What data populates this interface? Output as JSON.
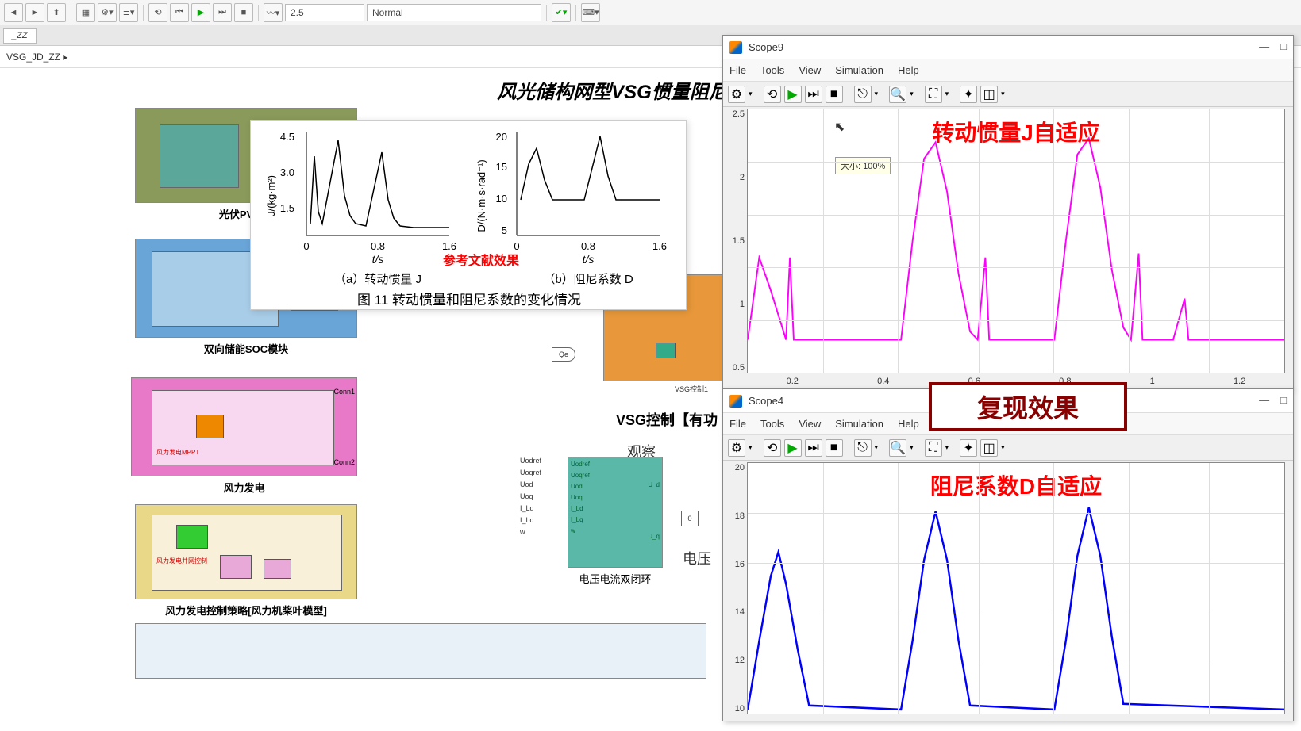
{
  "toolbar": {
    "stop_time": "2.5",
    "mode": "Normal"
  },
  "tab": "_ZZ",
  "breadcrumb": "VSG_JD_ZZ ▸",
  "canvas": {
    "title": "风光储构网型VSG惯量阻尼参数自适",
    "blocks": {
      "pv": "光伏PV+Bo",
      "soc": "双向储能SOC模块",
      "wind": "风力发电",
      "wind_ctrl": "风力发电控制策略[风力机桨叶模型]",
      "vsg_ctrl": "VSG控制【有功",
      "observe": "观察",
      "voltage": "电压",
      "vloop": "电压电流双闭环",
      "vsg_sub": "VSG控制1",
      "conn1": "Conn1",
      "conn2": "Conn2",
      "qe": "Qe",
      "zero": "0",
      "wind_mppt": "风力发电MPPT",
      "wind_grid": "风力发电并网控制"
    },
    "loop_ports": [
      "Uodref",
      "Uoqref",
      "Uod",
      "Uoq",
      "I_Ld",
      "I_Lq",
      "w"
    ],
    "loop_inner": [
      "Uodref",
      "Uoqref",
      "Uod",
      "Uoq",
      "I_Ld",
      "I_Lq",
      "w"
    ],
    "loop_out": [
      "U_d",
      "U_q"
    ]
  },
  "ref": {
    "y1_label": "J/(kg·m²)",
    "y2_label": "D/(N·m·s·rad⁻¹)",
    "x_label": "t/s",
    "sub_a": "（a）转动惯量 J",
    "sub_b": "（b）阻尼系数 D",
    "caption": "图 11   转动惯量和阻尼系数的变化情况",
    "red_label": "参考文献效果",
    "y1_ticks": [
      "4.5",
      "3.0",
      "1.5"
    ],
    "y2_ticks": [
      "20",
      "15",
      "10",
      "5"
    ],
    "x_ticks": [
      "0",
      "0.8",
      "1.6"
    ]
  },
  "scope9": {
    "title": "Scope9",
    "menus": [
      "File",
      "Tools",
      "View",
      "Simulation",
      "Help"
    ],
    "plot_title": "转动惯量J自适应",
    "tooltip": "大小: 100%",
    "y_ticks": [
      "2.5",
      "2",
      "1.5",
      "1",
      "0.5"
    ],
    "x_ticks": [
      "0.2",
      "0.4",
      "0.6",
      "0.8",
      "1",
      "1.2"
    ]
  },
  "scope4": {
    "title": "Scope4",
    "menus": [
      "File",
      "Tools",
      "View",
      "Simulation",
      "Help"
    ],
    "plot_title": "阻尼系数D自适应",
    "y_ticks": [
      "20",
      "18",
      "16",
      "14",
      "12",
      "10"
    ]
  },
  "redbox": "复现效果",
  "chart_data": [
    {
      "type": "line",
      "title": "转动惯量J自适应 (Scope9)",
      "xlabel": "t/s",
      "ylabel": "J",
      "xlim": [
        0,
        1.4
      ],
      "ylim": [
        0,
        2.5
      ],
      "series": [
        {
          "name": "J",
          "color": "#f0f",
          "x": [
            0.0,
            0.03,
            0.06,
            0.09,
            0.12,
            0.15,
            0.18,
            0.22,
            0.25,
            0.3,
            0.35,
            0.4,
            0.43,
            0.46,
            0.49,
            0.52,
            0.55,
            0.58,
            0.62,
            0.65,
            0.7,
            0.75,
            0.8,
            0.83,
            0.86,
            0.89,
            0.92,
            0.95,
            1.0,
            1.03,
            1.06,
            1.09,
            1.12,
            1.15,
            1.2,
            1.25,
            1.3,
            1.35,
            1.4
          ],
          "values": [
            0.3,
            1.0,
            0.8,
            0.6,
            0.4,
            0.3,
            0.3,
            1.1,
            0.3,
            0.3,
            0.3,
            0.3,
            1.0,
            1.7,
            2.1,
            1.8,
            1.2,
            0.6,
            0.3,
            0.3,
            1.1,
            0.3,
            0.3,
            1.0,
            1.7,
            2.1,
            1.8,
            1.2,
            0.6,
            0.3,
            0.3,
            1.2,
            0.3,
            0.3,
            0.3,
            0.7,
            0.3,
            0.3,
            0.3
          ]
        }
      ]
    },
    {
      "type": "line",
      "title": "阻尼系数D自适应 (Scope4)",
      "xlabel": "t/s",
      "ylabel": "D",
      "xlim": [
        0,
        1.4
      ],
      "ylim": [
        10,
        20
      ],
      "series": [
        {
          "name": "D",
          "color": "#00f",
          "x": [
            0.0,
            0.03,
            0.06,
            0.09,
            0.12,
            0.15,
            0.2,
            0.4,
            0.43,
            0.46,
            0.49,
            0.52,
            0.55,
            0.6,
            0.8,
            0.83,
            0.86,
            0.89,
            0.92,
            0.95,
            1.0,
            1.4
          ],
          "values": [
            10.0,
            13.0,
            15.5,
            16.5,
            15.0,
            12.0,
            10.0,
            10.0,
            13.0,
            16.0,
            18.0,
            16.0,
            12.5,
            10.0,
            10.0,
            13.0,
            16.0,
            18.2,
            16.0,
            12.5,
            10.0,
            10.0
          ]
        }
      ]
    },
    {
      "type": "line",
      "title": "参考文献 (a) 转动惯量 J",
      "xlabel": "t/s",
      "ylabel": "J/(kg·m²)",
      "xlim": [
        0,
        1.6
      ],
      "ylim": [
        0,
        4.5
      ],
      "x": [
        0.0,
        0.1,
        0.2,
        0.3,
        0.4,
        0.5,
        0.6,
        0.7,
        0.8,
        0.9,
        1.0,
        1.1,
        1.2,
        1.3,
        1.4,
        1.6
      ],
      "values": [
        0.5,
        3.5,
        1.0,
        0.5,
        4.5,
        2.0,
        1.0,
        0.6,
        0.5,
        4.0,
        2.0,
        1.0,
        0.6,
        0.5,
        0.5,
        0.5
      ]
    },
    {
      "type": "line",
      "title": "参考文献 (b) 阻尼系数 D",
      "xlabel": "t/s",
      "ylabel": "D/(N·m·s·rad⁻¹)",
      "xlim": [
        0,
        1.6
      ],
      "ylim": [
        5,
        20
      ],
      "x": [
        0.0,
        0.1,
        0.2,
        0.3,
        0.4,
        0.5,
        0.7,
        0.8,
        0.9,
        1.0,
        1.1,
        1.6
      ],
      "values": [
        10,
        15,
        18,
        12,
        10,
        10,
        10,
        14,
        20,
        13,
        10,
        10
      ]
    }
  ]
}
